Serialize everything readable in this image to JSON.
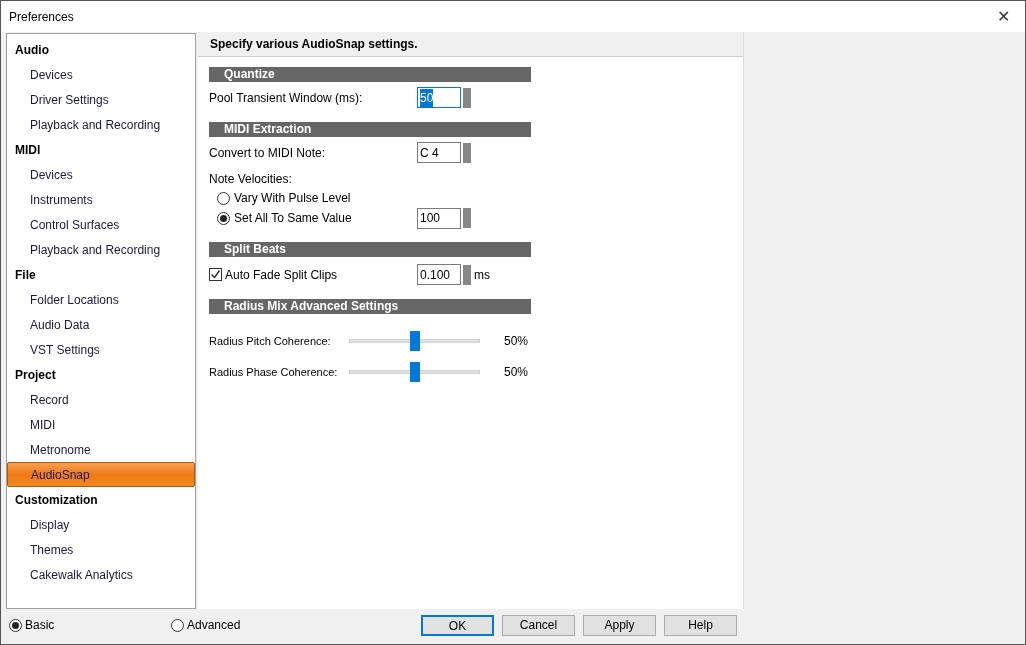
{
  "window": {
    "title": "Preferences",
    "close": "✕"
  },
  "sidebar": [
    {
      "label": "Audio",
      "children": [
        {
          "label": "Devices",
          "selected": false
        },
        {
          "label": "Driver Settings",
          "selected": false
        },
        {
          "label": "Playback and Recording",
          "selected": false
        }
      ]
    },
    {
      "label": "MIDI",
      "children": [
        {
          "label": "Devices",
          "selected": false
        },
        {
          "label": "Instruments",
          "selected": false
        },
        {
          "label": "Control Surfaces",
          "selected": false
        },
        {
          "label": "Playback and Recording",
          "selected": false
        }
      ]
    },
    {
      "label": "File",
      "children": [
        {
          "label": "Folder Locations",
          "selected": false
        },
        {
          "label": "Audio Data",
          "selected": false
        },
        {
          "label": "VST Settings",
          "selected": false
        }
      ]
    },
    {
      "label": "Project",
      "children": [
        {
          "label": "Record",
          "selected": false
        },
        {
          "label": "MIDI",
          "selected": false
        },
        {
          "label": "Metronome",
          "selected": false
        },
        {
          "label": "AudioSnap",
          "selected": true
        }
      ]
    },
    {
      "label": "Customization",
      "children": [
        {
          "label": "Display",
          "selected": false
        },
        {
          "label": "Themes",
          "selected": false
        },
        {
          "label": "Cakewalk Analytics",
          "selected": false
        }
      ]
    }
  ],
  "panel": {
    "header": "Specify various AudioSnap settings.",
    "sections": [
      {
        "title": "Quantize",
        "rows": [
          {
            "kind": "spin",
            "label": "Pool Transient Window (ms):",
            "value": "50",
            "focused": true
          }
        ]
      },
      {
        "title": "MIDI Extraction",
        "rows": [
          {
            "kind": "spin",
            "label": "Convert to MIDI Note:",
            "value": "C 4",
            "focused": false
          },
          {
            "kind": "label",
            "label": "Note Velocities:"
          },
          {
            "kind": "radio",
            "label": "Vary With Pulse Level",
            "selected": false
          },
          {
            "kind": "radio",
            "label": "Set All To Same Value",
            "selected": true,
            "value": "100"
          }
        ]
      },
      {
        "title": "Split Beats",
        "rows": [
          {
            "kind": "checkbox",
            "label": "Auto Fade Split Clips",
            "checked": true,
            "value": "0.100",
            "unit": "ms"
          }
        ]
      },
      {
        "title": "Radius Mix Advanced Settings",
        "rows": [
          {
            "kind": "slider",
            "label": "Radius Pitch Coherence:",
            "level": 0.5,
            "reading": "50%"
          },
          {
            "kind": "slider",
            "label": "Radius Phase Coherence:",
            "level": 0.5,
            "reading": "50%"
          }
        ]
      }
    ]
  },
  "modes": [
    {
      "label": "Basic",
      "selected": true
    },
    {
      "label": "Advanced",
      "selected": false
    }
  ],
  "buttons": [
    {
      "label": "OK",
      "default": true
    },
    {
      "label": "Cancel",
      "default": false
    },
    {
      "label": "Apply",
      "default": false
    },
    {
      "label": "Help",
      "default": false
    }
  ]
}
